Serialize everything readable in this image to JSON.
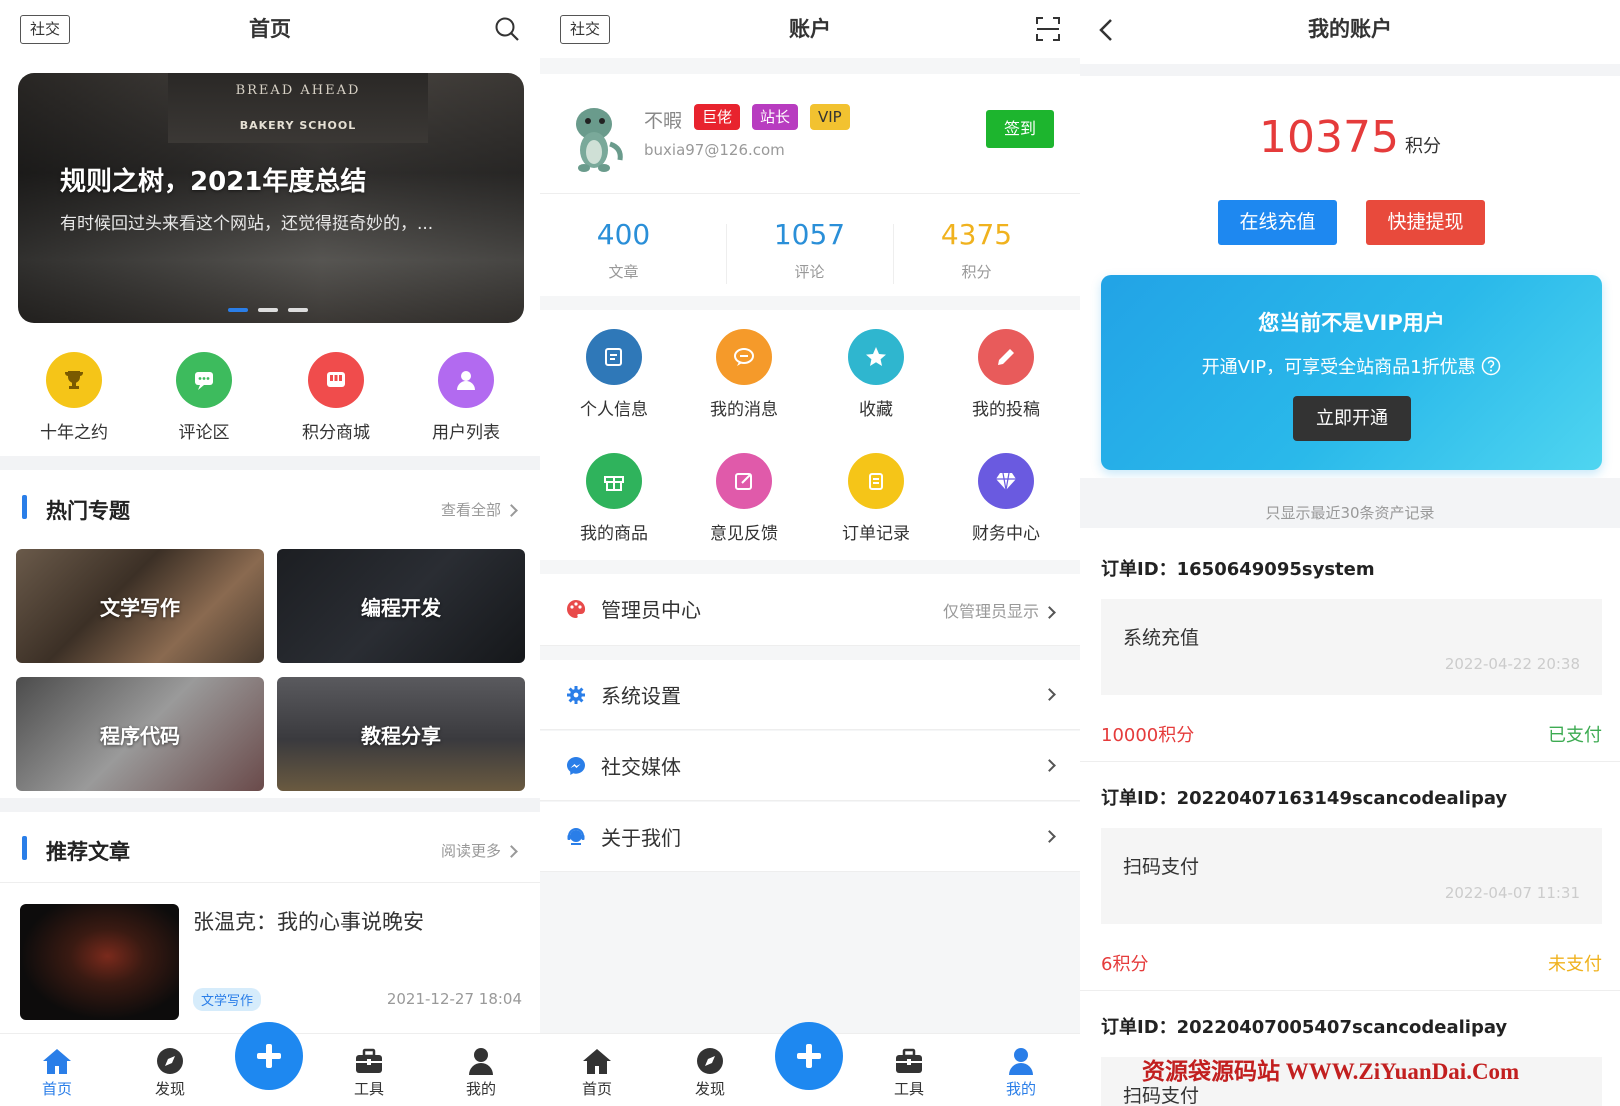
{
  "home": {
    "tag": "社交",
    "title": "首页",
    "banner": {
      "title": "规则之树，2021年度总结",
      "subtitle": "有时候回过头来看这个网站，还觉得挺奇妙的，...",
      "shop_sign": "BREAD AHEAD",
      "shop_sub": "BAKERY SCHOOL"
    },
    "quick": [
      {
        "label": "十年之约",
        "color": "#f5c518",
        "icon": "trophy-icon"
      },
      {
        "label": "评论区",
        "color": "#3dbb5d",
        "icon": "chat-icon"
      },
      {
        "label": "积分商城",
        "color": "#f04c4c",
        "icon": "shop-icon"
      },
      {
        "label": "用户列表",
        "color": "#b26af0",
        "icon": "user-icon"
      }
    ],
    "topics": {
      "title": "热门专题",
      "more": "查看全部",
      "items": [
        "文学写作",
        "编程开发",
        "程序代码",
        "教程分享"
      ]
    },
    "recommend": {
      "title": "推荐文章",
      "more": "阅读更多"
    },
    "article": {
      "title": "张温克：我的心事说晚安",
      "tag": "文学写作",
      "date": "2021-12-27 18:04"
    }
  },
  "tabs": {
    "home": "首页",
    "discover": "发现",
    "tools": "工具",
    "mine": "我的"
  },
  "account": {
    "tag": "社交",
    "title": "账户",
    "user": {
      "name": "不暇",
      "email": "buxia97@126.com",
      "badges": [
        "巨佬",
        "站长",
        "VIP"
      ],
      "sign": "签到"
    },
    "stats": [
      {
        "value": "400",
        "label": "文章",
        "color": "#2a8fd8"
      },
      {
        "value": "1057",
        "label": "评论",
        "color": "#2a8fd8"
      },
      {
        "value": "4375",
        "label": "积分",
        "color": "#f0b21e"
      }
    ],
    "grid": [
      {
        "label": "个人信息",
        "color": "#2f78b8",
        "icon": "edit-icon"
      },
      {
        "label": "我的消息",
        "color": "#f59a2a",
        "icon": "message-icon"
      },
      {
        "label": "收藏",
        "color": "#2fb6cf",
        "icon": "star-icon"
      },
      {
        "label": "我的投稿",
        "color": "#e85b5b",
        "icon": "pencil-icon"
      },
      {
        "label": "我的商品",
        "color": "#2fb35c",
        "icon": "gift-icon"
      },
      {
        "label": "意见反馈",
        "color": "#e05aaa",
        "icon": "feedback-icon"
      },
      {
        "label": "订单记录",
        "color": "#f5c518",
        "icon": "order-icon"
      },
      {
        "label": "财务中心",
        "color": "#6a5ae0",
        "icon": "diamond-icon"
      }
    ],
    "admin": {
      "label": "管理员中心",
      "note": "仅管理员显示"
    },
    "menu": [
      "系统设置",
      "社交媒体",
      "关于我们"
    ]
  },
  "wallet": {
    "title": "我的账户",
    "points": "10375",
    "points_unit": "积分",
    "recharge": "在线充值",
    "withdraw": "快捷提现",
    "vip": {
      "title": "您当前不是VIP用户",
      "desc": "开通VIP，可享受全站商品1折优惠",
      "button": "立即开通"
    },
    "note": "只显示最近30条资产记录",
    "orders": [
      {
        "id": "订单ID：1650649095system",
        "type": "系统充值",
        "date": "2022-04-22 20:38",
        "amount": "10000积分",
        "status": "已支付",
        "status_color": "#3dab52"
      },
      {
        "id": "订单ID：20220407163149scancodealipay",
        "type": "扫码支付",
        "date": "2022-04-07 11:31",
        "amount": "6积分",
        "status": "未支付",
        "status_color": "#f0b21e"
      },
      {
        "id": "订单ID：20220407005407scancodealipay",
        "type": "扫码支付"
      }
    ],
    "watermark": "资源袋源码站 WWW.ZiYuanDai.Com"
  }
}
